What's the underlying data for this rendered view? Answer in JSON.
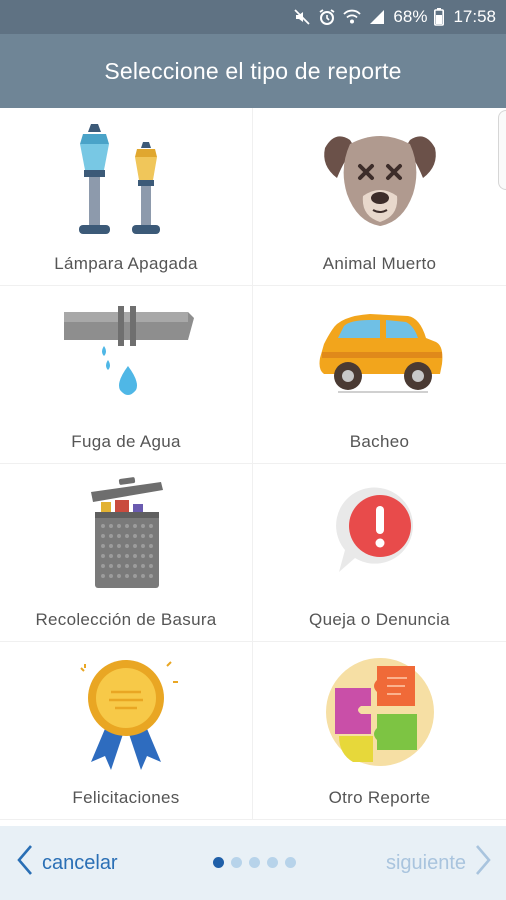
{
  "status_bar": {
    "icons": [
      "mute-icon",
      "alarm-icon",
      "wifi-icon",
      "signal-icon"
    ],
    "battery_percent": "68%",
    "time": "17:58"
  },
  "header": {
    "title": "Seleccione el tipo de reporte"
  },
  "report_types": [
    {
      "label": "Lámpara Apagada",
      "icon": "street-lamp-icon"
    },
    {
      "label": "Animal Muerto",
      "icon": "dead-dog-icon"
    },
    {
      "label": "Fuga de Agua",
      "icon": "leaking-pipe-icon"
    },
    {
      "label": "Bacheo",
      "icon": "car-pothole-icon"
    },
    {
      "label": "Recolección de Basura",
      "icon": "trash-can-icon"
    },
    {
      "label": "Queja o Denuncia",
      "icon": "alert-bubble-icon"
    },
    {
      "label": "Felicitaciones",
      "icon": "award-ribbon-icon"
    },
    {
      "label": "Otro Reporte",
      "icon": "puzzle-pieces-icon"
    }
  ],
  "footer": {
    "cancel_label": "cancelar",
    "next_label": "siguiente",
    "page_indicator": {
      "total": 5,
      "current": 1
    }
  },
  "colors": {
    "status_bar": "#5f7283",
    "app_bar": "#6f8596",
    "footer_bg": "#e8f0f6",
    "primary_blue": "#2a6fb5",
    "disabled_blue": "#a9c4de"
  }
}
